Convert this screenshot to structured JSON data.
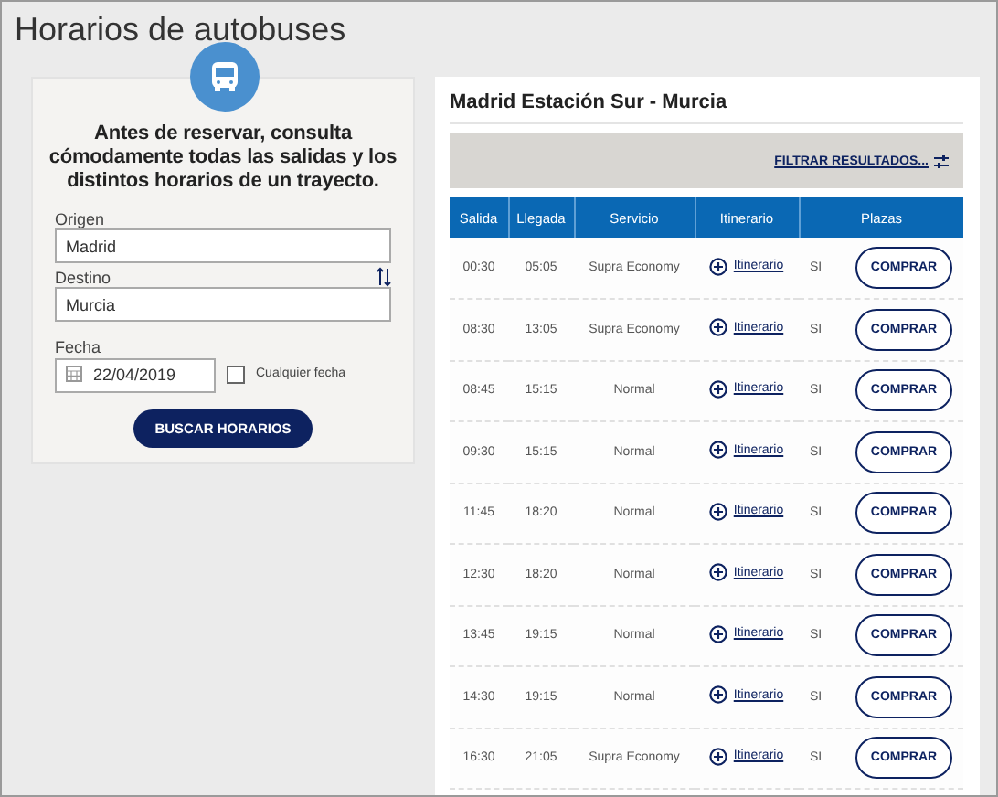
{
  "page_title": "Horarios de autobuses",
  "search": {
    "intro": "Antes de reservar, consulta cómodamente todas las salidas y los distintos horarios de un trayecto.",
    "origin": {
      "label": "Origen",
      "value": "Madrid"
    },
    "destination": {
      "label": "Destino",
      "value": "Murcia"
    },
    "date": {
      "label": "Fecha",
      "value": "22/04/2019"
    },
    "any_date": {
      "label": "Cualquier fecha",
      "checked": false
    },
    "button": "BUSCAR HORARIOS"
  },
  "results": {
    "title": "Madrid Estación Sur - Murcia",
    "filter": "FILTRAR RESULTADOS...",
    "columns": [
      "Salida",
      "Llegada",
      "Servicio",
      "Itinerario",
      "Plazas"
    ],
    "rows": [
      {
        "departure": "00:30",
        "arrival": "05:05",
        "service": "Supra Economy",
        "itinerary": "Itinerario",
        "seats": "SI",
        "action": "COMPRAR"
      },
      {
        "departure": "08:30",
        "arrival": "13:05",
        "service": "Supra Economy",
        "itinerary": "Itinerario",
        "seats": "SI",
        "action": "COMPRAR"
      },
      {
        "departure": "08:45",
        "arrival": "15:15",
        "service": "Normal",
        "itinerary": "Itinerario",
        "seats": "SI",
        "action": "COMPRAR"
      },
      {
        "departure": "09:30",
        "arrival": "15:15",
        "service": "Normal",
        "itinerary": "Itinerario",
        "seats": "SI",
        "action": "COMPRAR"
      },
      {
        "departure": "11:45",
        "arrival": "18:20",
        "service": "Normal",
        "itinerary": "Itinerario",
        "seats": "SI",
        "action": "COMPRAR"
      },
      {
        "departure": "12:30",
        "arrival": "18:20",
        "service": "Normal",
        "itinerary": "Itinerario",
        "seats": "SI",
        "action": "COMPRAR"
      },
      {
        "departure": "13:45",
        "arrival": "19:15",
        "service": "Normal",
        "itinerary": "Itinerario",
        "seats": "SI",
        "action": "COMPRAR"
      },
      {
        "departure": "14:30",
        "arrival": "19:15",
        "service": "Normal",
        "itinerary": "Itinerario",
        "seats": "SI",
        "action": "COMPRAR"
      },
      {
        "departure": "16:30",
        "arrival": "21:05",
        "service": "Supra Economy",
        "itinerary": "Itinerario",
        "seats": "SI",
        "action": "COMPRAR"
      }
    ]
  }
}
